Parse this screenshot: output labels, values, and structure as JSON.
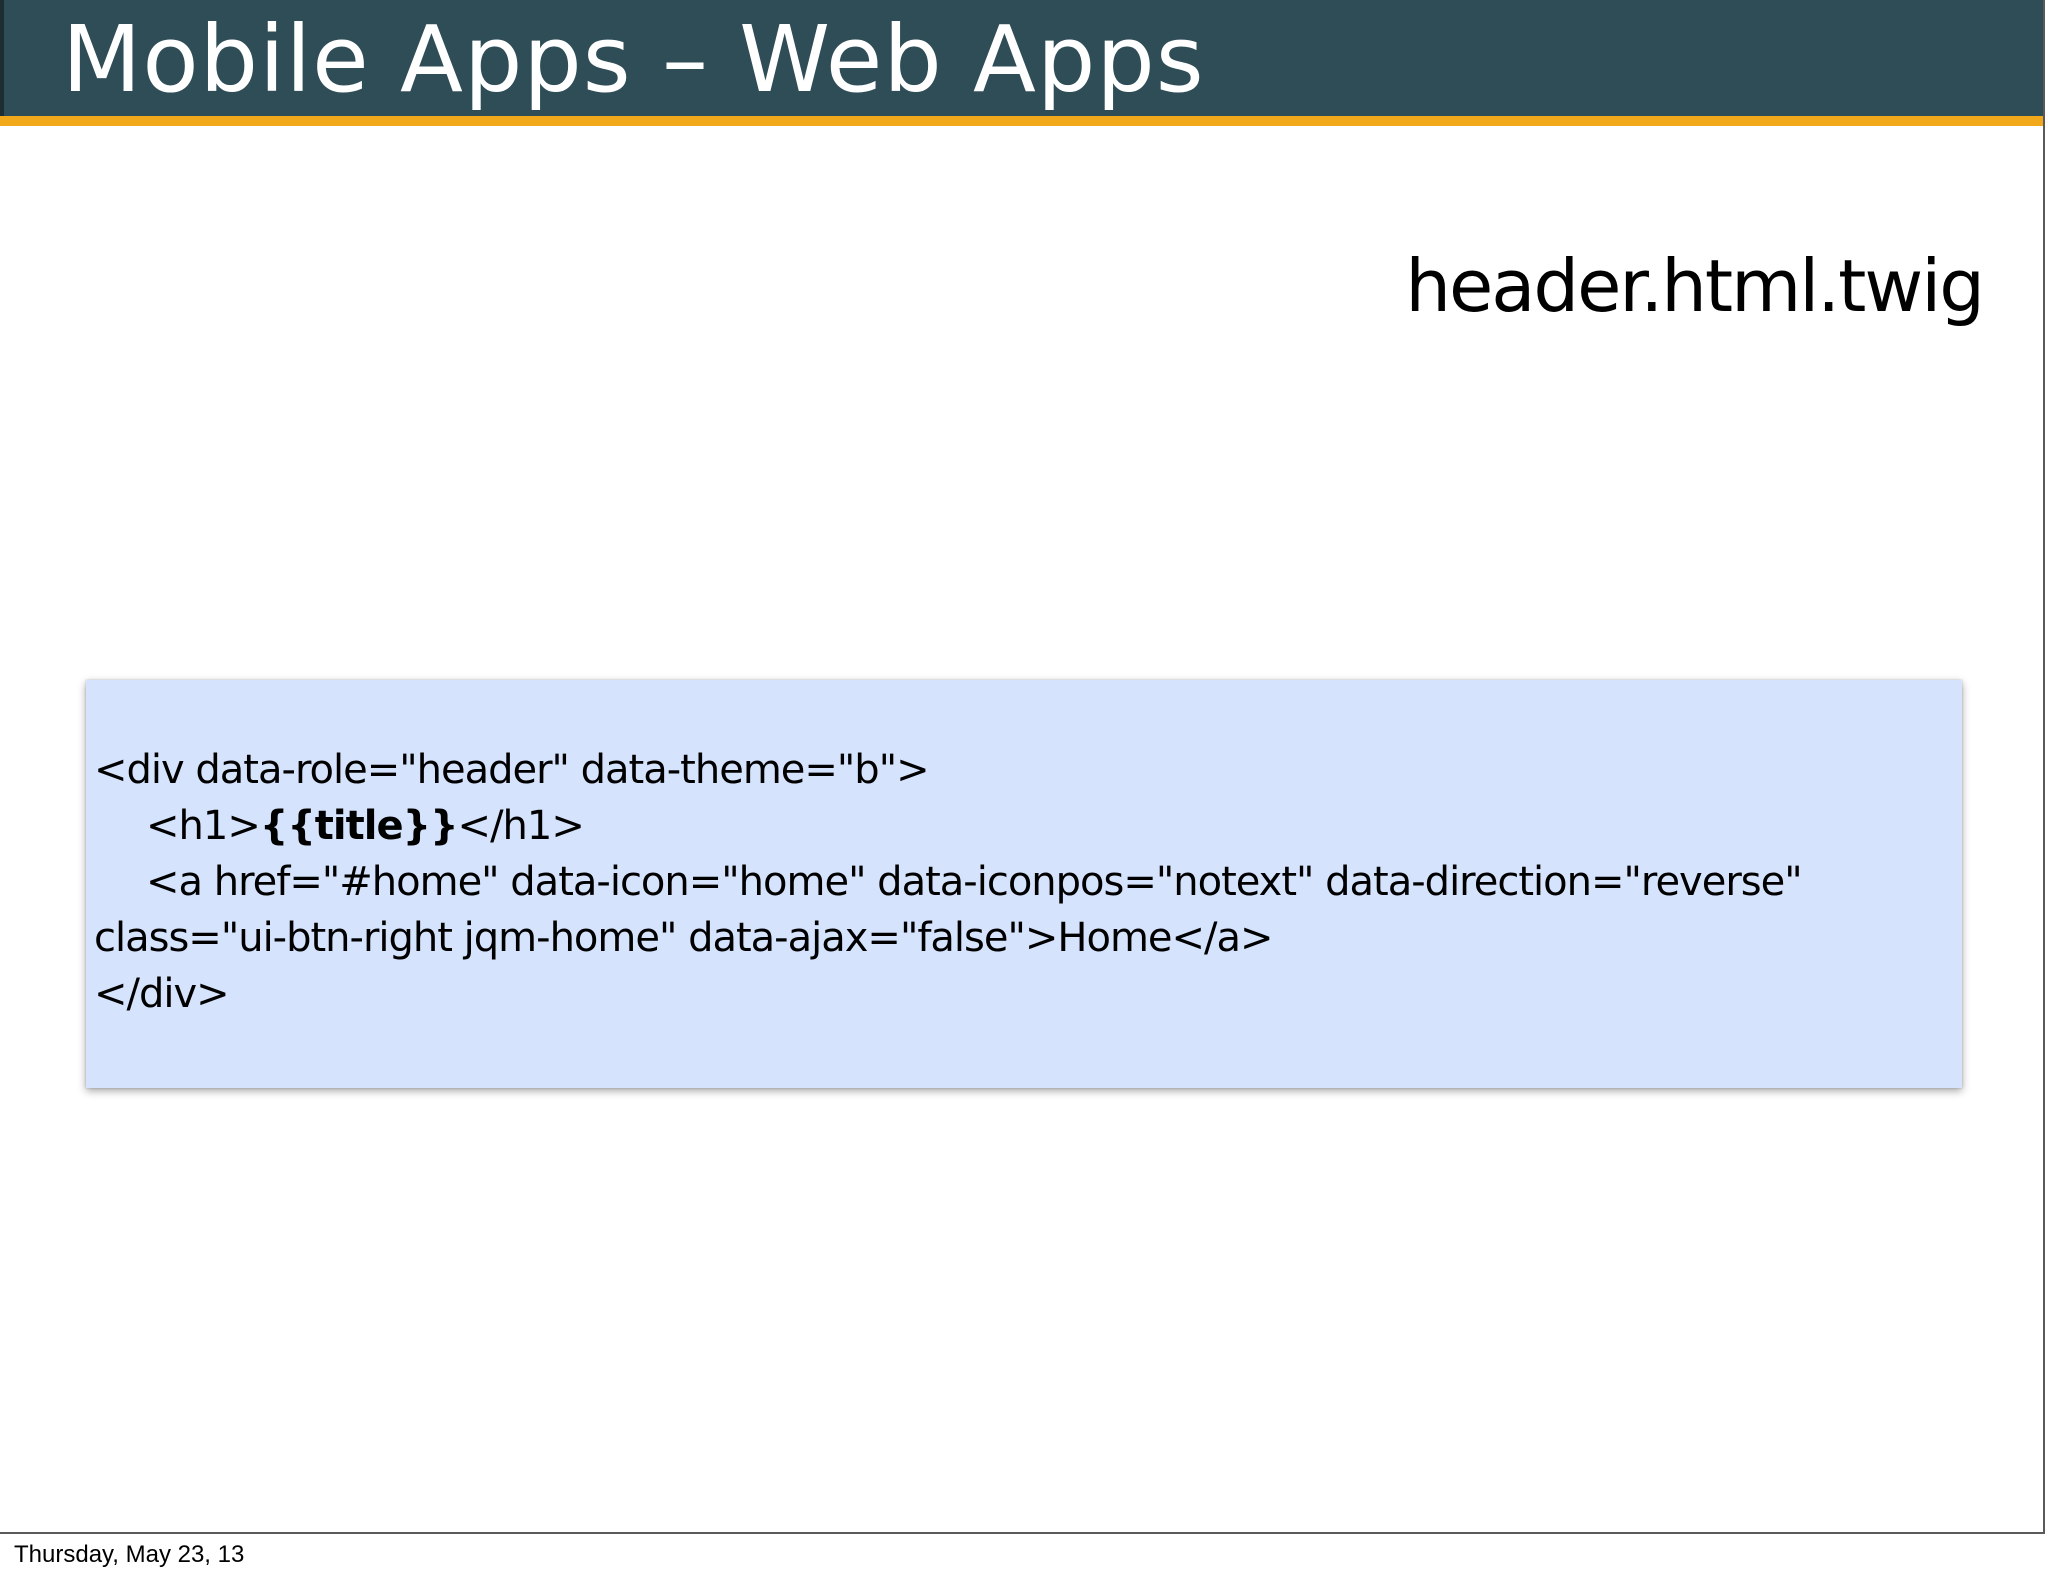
{
  "slide": {
    "title": "Mobile Apps – Web Apps",
    "file_name": "header.html.twig",
    "colors": {
      "title_bar": "#2f4d57",
      "accent": "#f2a81b",
      "code_background": "#d5e3fd"
    },
    "code": {
      "line1": "<div data-role=\"header\" data-theme=\"b\">",
      "line2_open": "<h1>",
      "line2_bold": "{{title}}",
      "line2_close": "</h1>",
      "line3": "<a href=\"#home\" data-icon=\"home\" data-iconpos=\"notext\" data-direction=\"reverse\"",
      "line4": "class=\"ui-btn-right jqm-home\" data-ajax=\"false\">Home</a>",
      "line5": "</div>"
    }
  },
  "footer": {
    "date": "Thursday, May 23, 13"
  }
}
